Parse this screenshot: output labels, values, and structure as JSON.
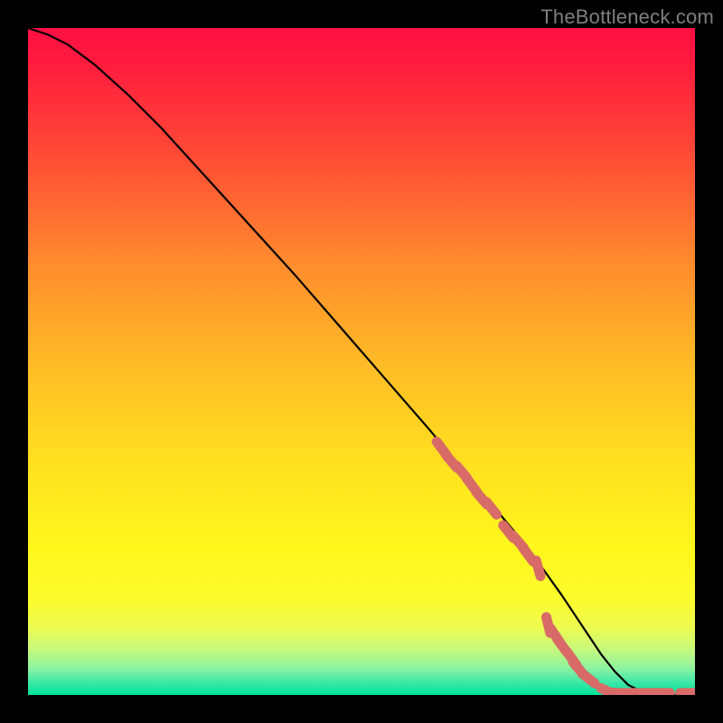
{
  "watermark": "TheBottleneck.com",
  "chart_data": {
    "type": "line",
    "title": "",
    "xlabel": "",
    "ylabel": "",
    "xlim": [
      0,
      100
    ],
    "ylim": [
      0,
      100
    ],
    "series": [
      {
        "name": "curve",
        "x": [
          0,
          3,
          6,
          10,
          15,
          20,
          30,
          40,
          50,
          60,
          65,
          70,
          75,
          80,
          82,
          84,
          86,
          88,
          90,
          92,
          94,
          96,
          98,
          100
        ],
        "y": [
          100,
          99,
          97.5,
          94.5,
          90,
          85,
          74,
          63,
          51.5,
          40,
          34,
          28,
          22,
          15,
          12,
          9,
          6,
          3.5,
          1.5,
          0.5,
          0,
          0,
          0,
          0
        ]
      }
    ],
    "markers": [
      {
        "name": "dash-cluster",
        "color": "#d86b67",
        "points_xy": [
          [
            62,
            37
          ],
          [
            63.5,
            35
          ],
          [
            65,
            33.5
          ],
          [
            66.5,
            31.5
          ],
          [
            68,
            29.5
          ],
          [
            69.5,
            28
          ],
          [
            72,
            24.5
          ],
          [
            73.5,
            23
          ],
          [
            75,
            21
          ],
          [
            76.5,
            19
          ],
          [
            78,
            10.5
          ],
          [
            79,
            9
          ],
          [
            80,
            7.5
          ],
          [
            81.5,
            5.5
          ],
          [
            82.5,
            4
          ],
          [
            84,
            2.5
          ],
          [
            87,
            0.5
          ],
          [
            88.5,
            0.3
          ],
          [
            90,
            0.3
          ],
          [
            93,
            0.3
          ],
          [
            95,
            0.3
          ],
          [
            99,
            0.3
          ]
        ]
      }
    ]
  }
}
